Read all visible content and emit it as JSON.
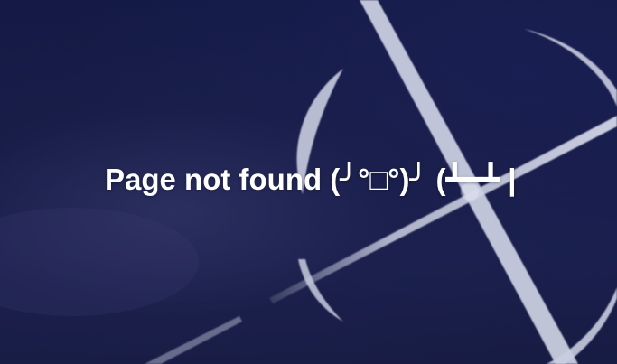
{
  "page": {
    "message": "Page not found (╯°□°)╯ (┻━┻ |",
    "background_icon": "crosshair-scope-icon"
  },
  "colors": {
    "background": "#161b46",
    "decoration": "#c9cde0",
    "text": "#ffffff"
  }
}
